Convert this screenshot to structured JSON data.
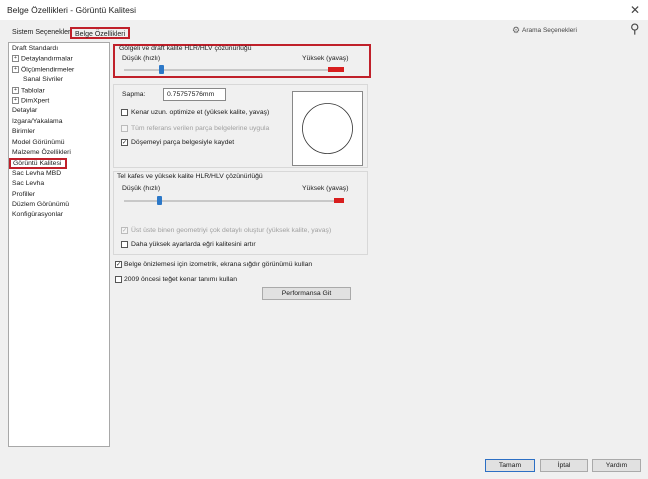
{
  "window": {
    "title": "Belge Özellikleri - Görüntü Kalitesi"
  },
  "tabs": [
    {
      "label": "Sistem Seçenekleri"
    },
    {
      "label": "Belge Özellikleri"
    }
  ],
  "search": {
    "placeholder": "Arama Seçenekleri"
  },
  "tree": [
    {
      "label": "Draft Standardı",
      "level": 0,
      "expander": false
    },
    {
      "label": "Detaylandırmalar",
      "level": 1,
      "expander": true
    },
    {
      "label": "Ölçümlendirmeler",
      "level": 1,
      "expander": true
    },
    {
      "label": "Sanal Sivriler",
      "level": 2,
      "expander": false
    },
    {
      "label": "Tablolar",
      "level": 1,
      "expander": true
    },
    {
      "label": "DimXpert",
      "level": 1,
      "expander": true
    },
    {
      "label": "Detaylar",
      "level": 0,
      "expander": false
    },
    {
      "label": "Izgara/Yakalama",
      "level": 0,
      "expander": false
    },
    {
      "label": "Birimler",
      "level": 0,
      "expander": false
    },
    {
      "label": "Model Görünümü",
      "level": 0,
      "expander": false
    },
    {
      "label": "Malzeme Özellikleri",
      "level": 0,
      "expander": false
    },
    {
      "label": "Görüntü Kalitesi",
      "level": 0,
      "expander": false,
      "selected": true
    },
    {
      "label": "Sac Levha MBD",
      "level": 0,
      "expander": false
    },
    {
      "label": "Sac Levha",
      "level": 0,
      "expander": false
    },
    {
      "label": "Profiller",
      "level": 0,
      "expander": false
    },
    {
      "label": "Düzlem Görünümü",
      "level": 0,
      "expander": false
    },
    {
      "label": "Konfigürasyonlar",
      "level": 0,
      "expander": false
    }
  ],
  "shaded": {
    "title": "Gölgeli ve draft kalite HLR/HLV çözünürlüğü",
    "low_label": "Düşük (hızlı)",
    "high_label": "Yüksek (yavaş)",
    "slider_value": 0.17
  },
  "deviation": {
    "label": "Sapma:",
    "value": "0.75757576mm"
  },
  "options1": [
    {
      "label": "Kenar uzun. optimize et (yüksek kalite, yavaş)",
      "checked": false,
      "disabled": false
    },
    {
      "label": "Tüm referans verilen parça belgelerine uygula",
      "checked": false,
      "disabled": true
    },
    {
      "label": "Döşemeyi parça belgesiyle kaydet",
      "checked": true,
      "disabled": false
    }
  ],
  "wireframe": {
    "title": "Tel kafes ve yüksek kalite HLR/HLV çözünürlüğü",
    "low_label": "Düşük (hızlı)",
    "high_label": "Yüksek (yavaş)",
    "slider_value": 0.16
  },
  "options2": [
    {
      "label": "Üst üste binen geometriyi çok detaylı oluştur (yüksek kalite, yavaş)",
      "checked": true,
      "disabled": true
    },
    {
      "label": "Daha yüksek ayarlarda eğri kalitesini artır",
      "checked": false,
      "disabled": false
    }
  ],
  "options3": [
    {
      "label": "Belge önizlemesi için izometrik, ekrana sığdır görünümü kullan",
      "checked": true,
      "disabled": false
    },
    {
      "label": "2009 öncesi teğet kenar tanımı kullan",
      "checked": false,
      "disabled": false
    }
  ],
  "performance_button": "Performansa Git",
  "footer": {
    "ok": "Tamam",
    "cancel": "İptal",
    "help": "Yardım"
  },
  "colors": {
    "accent": "#2c78c8",
    "highlight_border": "#c0202a",
    "slider_high": "#d81e1e"
  }
}
